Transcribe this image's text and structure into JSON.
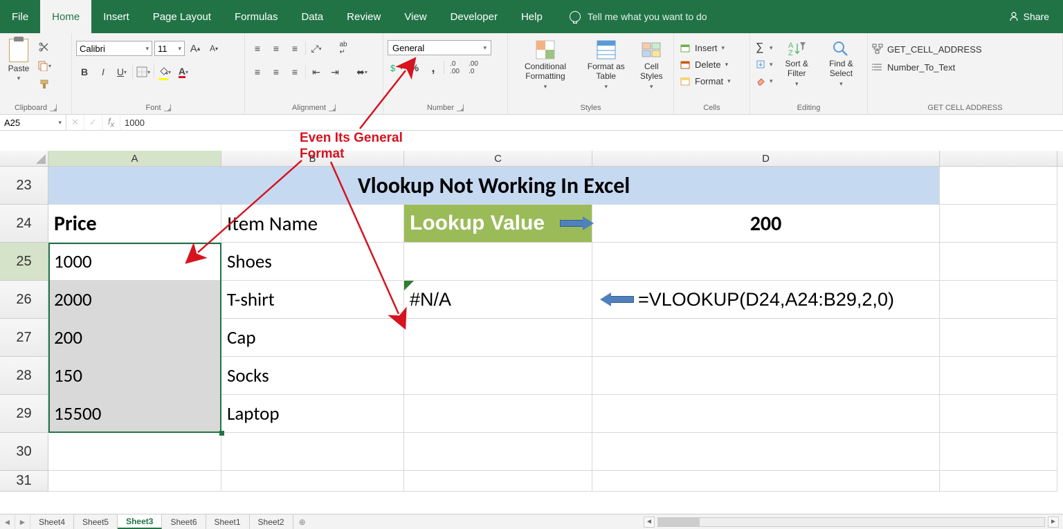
{
  "tabs": {
    "file": "File",
    "home": "Home",
    "insert": "Insert",
    "pagelayout": "Page Layout",
    "formulas": "Formulas",
    "data": "Data",
    "review": "Review",
    "view": "View",
    "developer": "Developer",
    "help": "Help",
    "tellme": "Tell me what you want to do",
    "share": "Share"
  },
  "ribbon": {
    "clipboard": {
      "paste": "Paste",
      "label": "Clipboard"
    },
    "font": {
      "name": "Calibri",
      "size": "11",
      "label": "Font"
    },
    "alignment": {
      "label": "Alignment"
    },
    "number": {
      "format": "General",
      "label": "Number"
    },
    "styles": {
      "cond": "Conditional Formatting",
      "fat": "Format as Table",
      "cellstyles": "Cell Styles",
      "label": "Styles"
    },
    "cells": {
      "insert": "Insert",
      "delete": "Delete",
      "format": "Format",
      "label": "Cells"
    },
    "editing": {
      "sort": "Sort & Filter",
      "find": "Find & Select",
      "label": "Editing"
    },
    "addins": {
      "a": "GET_CELL_ADDRESS",
      "b": "Number_To_Text",
      "label": "GET CELL ADDRESS"
    }
  },
  "namebox": "A25",
  "formula": "1000",
  "annotation": {
    "l1": "Even Its General",
    "l2": "Format"
  },
  "colheads": [
    "A",
    "B",
    "C",
    "D"
  ],
  "rowheads": [
    "23",
    "24",
    "25",
    "26",
    "27",
    "28",
    "29",
    "30",
    "31"
  ],
  "cells": {
    "title": "Vlookup Not Working In Excel",
    "A24": "Price",
    "B24": "Item Name",
    "C24": "Lookup Value",
    "D24": "200",
    "A25": "1000",
    "B25": "Shoes",
    "A26": "2000",
    "B26": "T-shirt",
    "C26": "#N/A",
    "D26": "=VLOOKUP(D24,A24:B29,2,0)",
    "A27": "200",
    "B27": "Cap",
    "A28": "150",
    "B28": "Socks",
    "A29": "15500",
    "B29": "Laptop"
  },
  "sheets": [
    "Sheet4",
    "Sheet5",
    "Sheet3",
    "Sheet6",
    "Sheet1",
    "Sheet2"
  ],
  "active_sheet": "Sheet3",
  "chart_data": {
    "type": "table",
    "title": "Vlookup Not Working In Excel",
    "columns": [
      "Price",
      "Item Name"
    ],
    "rows": [
      [
        "1000",
        "Shoes"
      ],
      [
        "2000",
        "T-shirt"
      ],
      [
        "200",
        "Cap"
      ],
      [
        "150",
        "Socks"
      ],
      [
        "15500",
        "Laptop"
      ]
    ],
    "lookup_value": 200,
    "lookup_result": "#N/A",
    "formula": "=VLOOKUP(D24,A24:B29,2,0)",
    "number_format": "General"
  }
}
